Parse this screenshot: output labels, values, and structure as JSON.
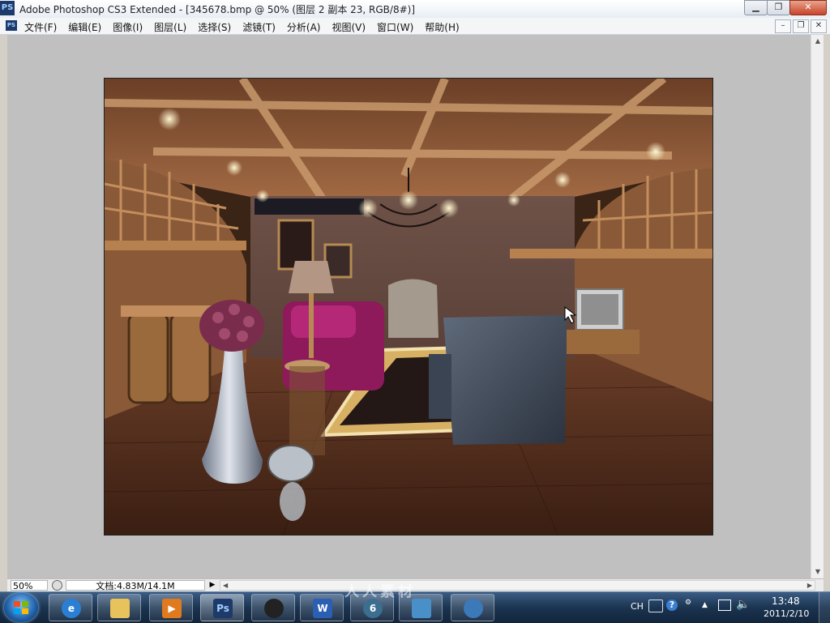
{
  "window": {
    "app_icon": "PS",
    "title": "Adobe Photoshop CS3 Extended - [345678.bmp @ 50% (图层 2 副本 23, RGB/8#)]",
    "minimize": "▁",
    "restore": "❐",
    "close": "✕"
  },
  "menu": {
    "doc_icon": "PS",
    "items": [
      "文件(F)",
      "编辑(E)",
      "图像(I)",
      "图层(L)",
      "选择(S)",
      "滤镜(T)",
      "分析(A)",
      "视图(V)",
      "窗口(W)",
      "帮助(H)"
    ],
    "doc_minimize": "–",
    "doc_restore": "❐",
    "doc_close": "✕"
  },
  "document": {
    "file_name": "345678.bmp",
    "zoom": "50%",
    "layer": "图层 2 副本 23",
    "image_description": "wine cellar interior render"
  },
  "status": {
    "zoom": "50%",
    "doc_info": "文档:4.83M/14.1M",
    "arrow": "▶",
    "left_arrow": "◀",
    "right_arrow": "▶"
  },
  "taskbar": {
    "apps": [
      {
        "name": "internet-explorer",
        "label": "e",
        "color": "#2a7fd4"
      },
      {
        "name": "file-explorer",
        "label": "",
        "color": "#e8c25a"
      },
      {
        "name": "media-player",
        "label": "▶",
        "color": "#e07a1f"
      },
      {
        "name": "photoshop",
        "label": "Ps",
        "color": "#1e3a6b"
      },
      {
        "name": "qq",
        "label": "",
        "color": "#222222"
      },
      {
        "name": "word",
        "label": "W",
        "color": "#2b5fb3"
      },
      {
        "name": "app-6",
        "label": "6",
        "color": "#3c6e8f"
      },
      {
        "name": "image-viewer",
        "label": "",
        "color": "#4a90c8"
      },
      {
        "name": "app-share",
        "label": "",
        "color": "#3b79b8"
      }
    ],
    "tray": {
      "lang": "CH",
      "help": "?",
      "time": "13:48",
      "date": "2011/2/10"
    }
  },
  "watermark": "人人素材"
}
